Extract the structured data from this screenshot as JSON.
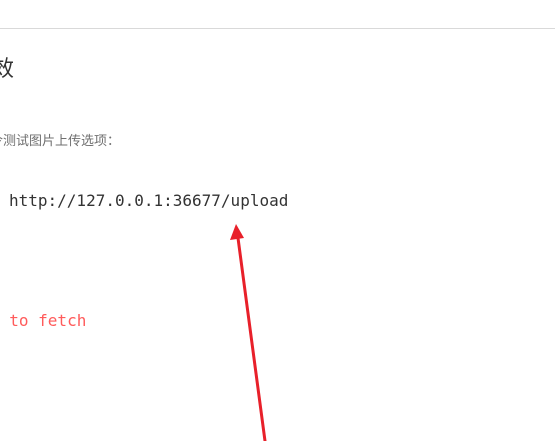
{
  "heading": "效",
  "description": "令测试图片上传选项：",
  "command": "http://127.0.0.1:36677/upload",
  "error": "d to fetch",
  "annotation_color": "#e8202a"
}
